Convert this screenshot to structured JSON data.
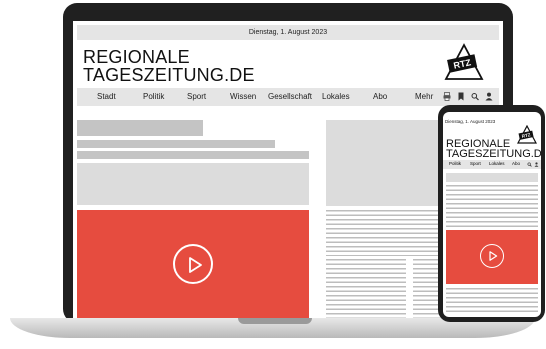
{
  "laptop": {
    "date": "Dienstag, 1. August 2023",
    "logo_line1": "REGIONALE",
    "logo_line2": "TAGESZEITUNG.DE",
    "badge": "RTZ",
    "nav": [
      "Stadt",
      "Politik",
      "Sport",
      "Wissen",
      "Gesellschaft",
      "Lokales",
      "Abo",
      "Mehr"
    ],
    "icons": [
      "print-icon",
      "bookmark-icon",
      "search-icon",
      "user-icon"
    ]
  },
  "phone": {
    "date": "Dienstag, 1. August 2023",
    "logo_line1": "REGIONALE",
    "logo_line2": "TAGESZEITUNG.DE",
    "badge": "RTZ",
    "nav": [
      "Politik",
      "Sport",
      "Lokales",
      "Abo"
    ],
    "icons": [
      "search-icon",
      "user-icon"
    ]
  },
  "colors": {
    "video": "#e64c3f",
    "placeholder": "#c4c4c4",
    "bar_background": "#e5e5e5"
  }
}
